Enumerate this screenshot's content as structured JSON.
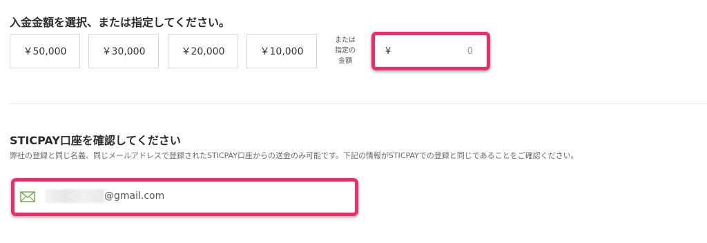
{
  "deposit": {
    "title": "入金金額を選択、または指定してください。",
    "amounts": [
      "￥50,000",
      "￥30,000",
      "￥20,000",
      "￥10,000"
    ],
    "custom_label_lines": [
      "または",
      "指定の",
      "金額"
    ],
    "currency_symbol": "¥",
    "custom_value": "0"
  },
  "account": {
    "title": "STICPAY口座を確認してください",
    "description": "弊社の登録と同じ名義、同じメールアドレスで登録されたSTICPAY口座からの送金のみ可能です。下記の情報がSTICPAYでの登録と同じであることをご確認ください。",
    "email_suffix": "@gmail.com"
  },
  "colors": {
    "highlight": "#ee2d66",
    "mail_icon": "#6ab04c"
  },
  "icons": {
    "email": "envelope-icon"
  }
}
